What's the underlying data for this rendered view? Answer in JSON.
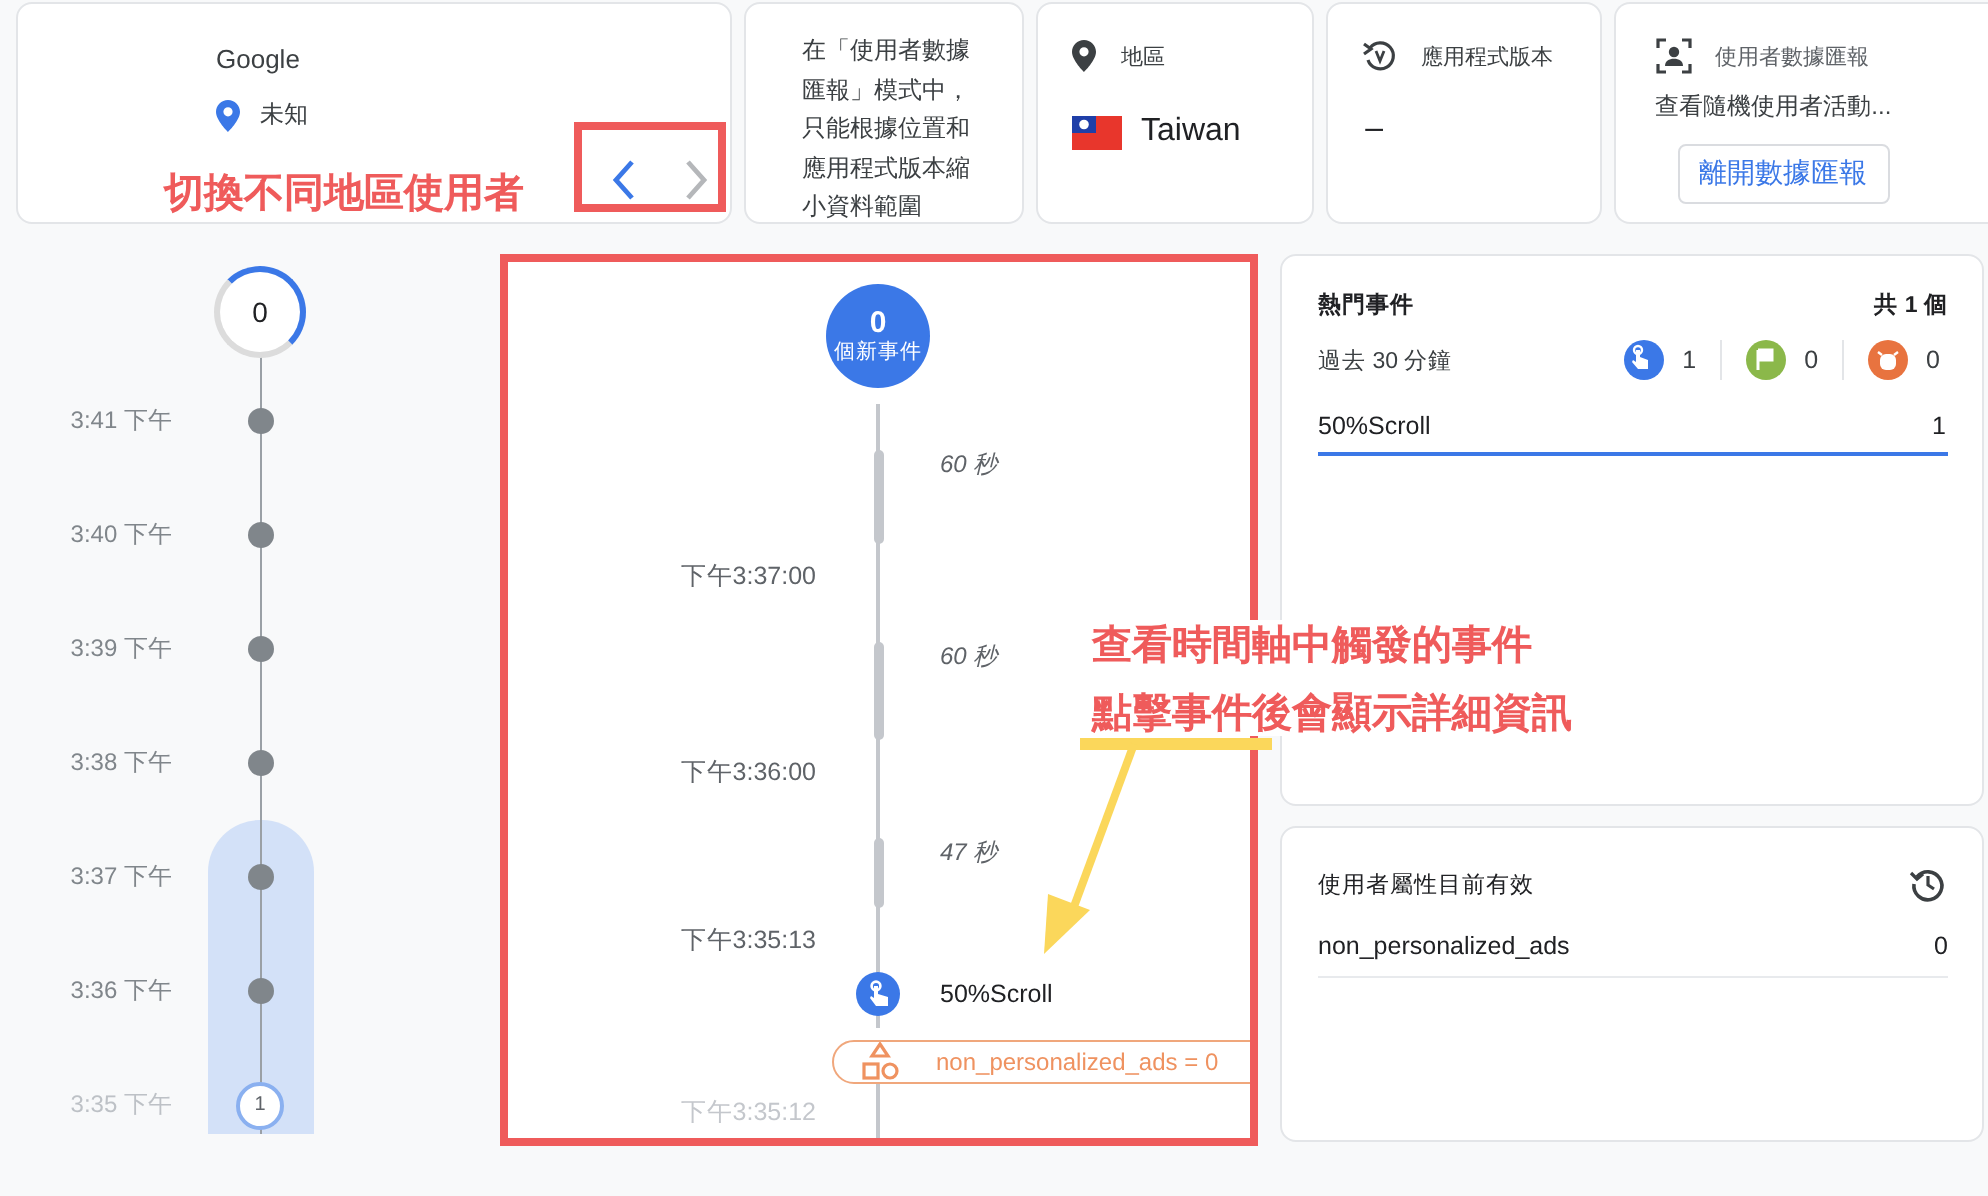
{
  "user_card": {
    "name": "Google",
    "location": "未知",
    "nav": [
      {
        "kind": "prev",
        "disabled": false
      },
      {
        "kind": "next",
        "disabled": true
      }
    ]
  },
  "info_cards": [
    {
      "kind": "note",
      "text": "在「使用者數據匯報」模式中，只能根據位置和應用程式版本縮小資料範圍"
    },
    {
      "kind": "region",
      "label": "地區",
      "value": "Taiwan"
    },
    {
      "kind": "version",
      "label": "應用程式版本",
      "value": "–"
    },
    {
      "kind": "report",
      "label": "使用者數據匯報",
      "text": "查看隨機使用者活動...",
      "button": "離開數據匯報"
    }
  ],
  "minute_timeline": {
    "current_count": "0",
    "rows": [
      {
        "time": "3:41 下午",
        "kind": "dot",
        "selected": false
      },
      {
        "time": "3:40 下午",
        "kind": "dot",
        "selected": false
      },
      {
        "time": "3:39 下午",
        "kind": "dot",
        "selected": false
      },
      {
        "time": "3:38 下午",
        "kind": "dot",
        "selected": false
      },
      {
        "time": "3:37 下午",
        "kind": "dot",
        "selected": true
      },
      {
        "time": "3:36 下午",
        "kind": "dot",
        "selected": true
      },
      {
        "time": "3:35 下午",
        "kind": "count",
        "count": "1",
        "selected": true
      }
    ]
  },
  "event_stream": {
    "new_count": "0",
    "new_label": "個新事件",
    "items": [
      {
        "kind": "gap",
        "duration": "60 秒"
      },
      {
        "kind": "time",
        "time": "下午3:37:00"
      },
      {
        "kind": "gap",
        "duration": "60 秒"
      },
      {
        "kind": "time",
        "time": "下午3:36:00"
      },
      {
        "kind": "gap",
        "duration": "47 秒"
      },
      {
        "kind": "time",
        "time": "下午3:35:13"
      },
      {
        "kind": "event",
        "name": "50%Scroll"
      },
      {
        "kind": "property",
        "text": "non_personalized_ads = 0"
      },
      {
        "kind": "time",
        "time": "下午3:35:12"
      }
    ]
  },
  "top_events": {
    "title": "熱門事件",
    "total": "共 1 個",
    "period": "過去 30 分鐘",
    "counters": [
      {
        "kind": "event",
        "count": "1",
        "color": "#3b78e7"
      },
      {
        "kind": "conversion",
        "count": "0",
        "color": "#8bb84a"
      },
      {
        "kind": "error",
        "count": "0",
        "color": "#e8733f"
      }
    ],
    "rows": [
      {
        "name": "50%Scroll",
        "count": "1",
        "selected": true
      }
    ]
  },
  "user_properties": {
    "title": "使用者屬性目前有效",
    "rows": [
      {
        "name": "non_personalized_ads",
        "value": "0"
      }
    ]
  },
  "annotations": [
    {
      "kind": "nav-label",
      "text": "切換不同地區使用者"
    },
    {
      "kind": "callout",
      "lines": [
        "查看時間軸中觸發的事件",
        "點擊事件後會顯示詳細資訊"
      ]
    }
  ]
}
